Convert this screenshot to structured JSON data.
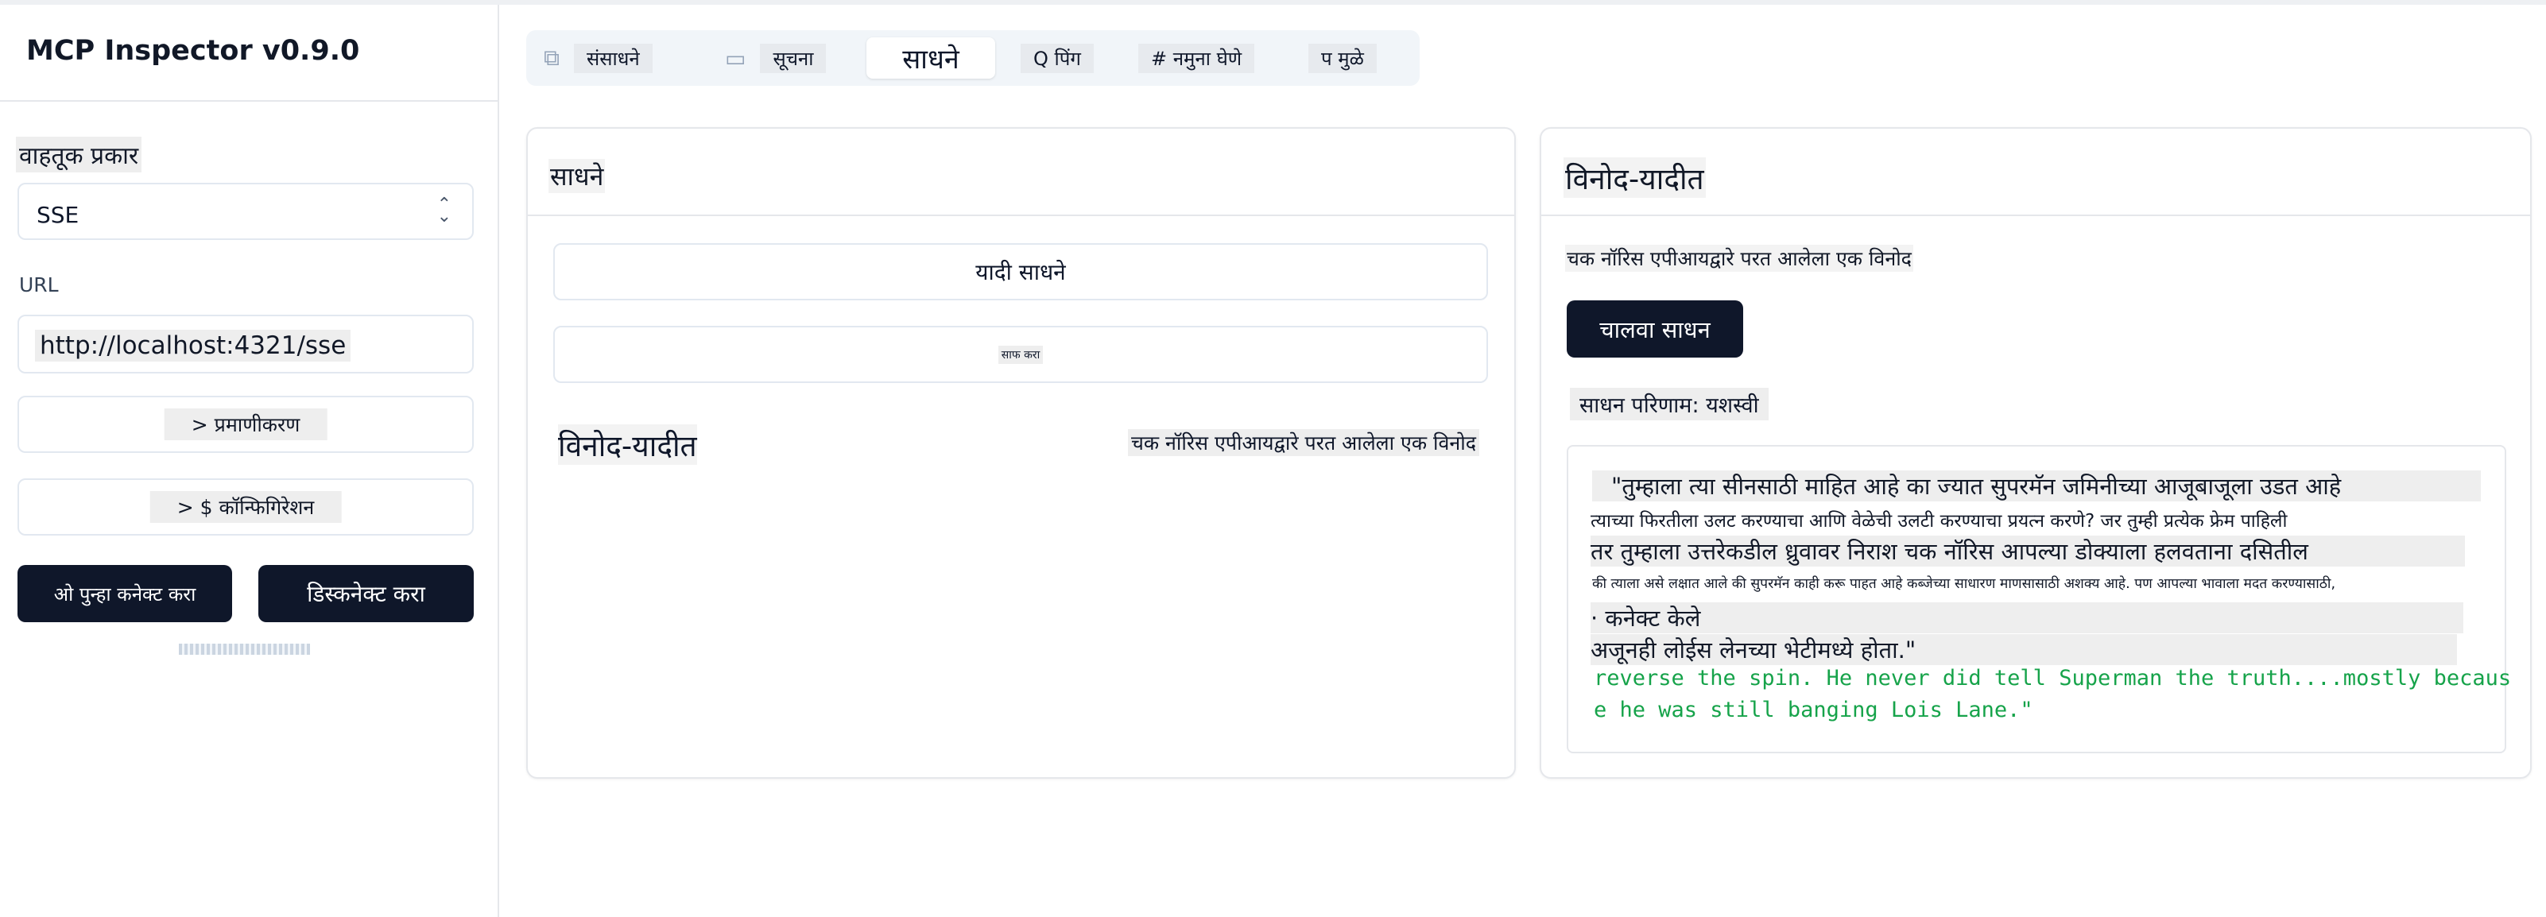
{
  "sidebar": {
    "title": "MCP Inspector v0.9.0",
    "transport_label": "वाहतूक प्रकार",
    "transport_value": "SSE",
    "url_label": "URL",
    "url_value": "http://localhost:4321/sse",
    "auth_button": "> प्रमाणीकरण",
    "config_button": "> $ कॉन्फिगिरेशन",
    "reconnect_button": "ओ पुन्हा कनेक्ट करा",
    "disconnect_button": "डिस्कनेक्ट करा"
  },
  "tabs": [
    {
      "label": "संसाधने",
      "icon": "copy-icon"
    },
    {
      "label": "सूचना",
      "icon": "chat-bubble-icon"
    },
    {
      "label": "साधने",
      "active": true
    },
    {
      "label": "Q पिंग"
    },
    {
      "label": "# नमुना घेणे"
    },
    {
      "label": "प मुळे"
    }
  ],
  "tools_panel": {
    "title": "साधने",
    "list_button": "यादी साधने",
    "clear_button": "साफ करा",
    "tool": {
      "name": "विनोद-यादीत",
      "description": "चक नॉरिस एपीआयद्वारे परत आलेला एक विनोद"
    }
  },
  "detail_panel": {
    "title": "विनोद-यादीत",
    "description": "चक नॉरिस एपीआयद्वारे परत आलेला एक विनोद",
    "run_button": "चालवा साधन",
    "result_label": "साधन परिणाम: यशस्वी",
    "result_lines": [
      "\"तुम्हाला त्या सीनसाठी माहित आहे का ज्यात सुपरमॅन जमिनीच्या आजूबाजूला उडत आहे",
      "त्याच्या फिरतीला उलट करण्याचा आणि वेळेची उलटी करण्याचा प्रयत्न करणे? जर तुम्ही प्रत्येक फ्रेम पाहिली",
      "तर तुम्हाला उत्तरेकडील ध्रुवावर निराश चक नॉरिस आपल्या डोक्याला हलवताना दसितील",
      "की त्याला असे लक्षात आले की सुपरमॅन काही करू पाहत आहे कब्जेच्या साधारण माणसासाठी अशक्य आहे. पण आपल्या भावाला मदत करण्यासाठी,",
      "· कनेक्ट केले",
      "अजूनही लोईस लेनच्या भेटीमध्ये होता.\""
    ],
    "code_lines": [
      "reverse the spin. He never did tell Superman the truth....mostly becaus",
      "e he was still banging Lois Lane.\""
    ]
  }
}
